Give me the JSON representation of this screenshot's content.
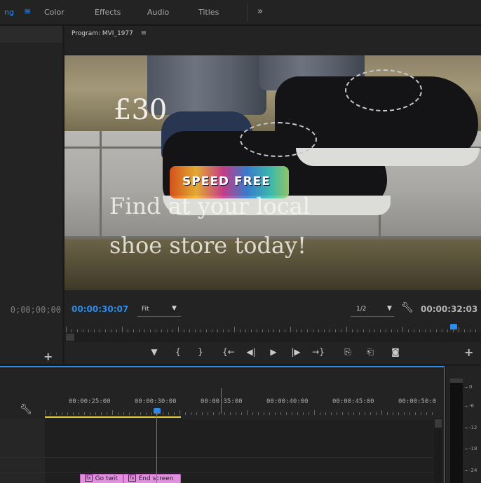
{
  "topbar": {
    "workspaces": [
      "ng",
      "Color",
      "Effects",
      "Audio",
      "Titles"
    ],
    "more": "»"
  },
  "source": {
    "timecode": "0;00;00;00",
    "add_button": "+"
  },
  "program": {
    "title": "Program: MVI_1977",
    "menu_icon": "≡",
    "overlay": {
      "price": "£30",
      "caption_line1": "Find at your local",
      "caption_line2": "shoe store today!",
      "shoe_logo": "SPEED FREE"
    },
    "current_time": "00:00:30:07",
    "zoom": "Fit",
    "resolution": "1/2",
    "duration": "00:00:32:03",
    "add_button": "+",
    "transport_icons": [
      "marker-icon",
      "mark-in-icon",
      "mark-out-icon",
      "go-to-in-icon",
      "step-back-icon",
      "play-icon",
      "step-forward-icon",
      "go-to-out-icon",
      "lift-icon",
      "extract-icon",
      "export-frame-icon"
    ],
    "transport_glyphs": [
      "▼",
      "{",
      "}",
      "{←",
      "◀|",
      "▶",
      "|▶",
      "→}",
      "⎘",
      "⎗",
      "◙"
    ]
  },
  "timeline": {
    "ruler_labels": [
      "00:00:25:00",
      "00:00:30:00",
      "00:00:35:00",
      "00:00:40:00",
      "00:00:45:00",
      "00:00:50:0"
    ],
    "clips": [
      {
        "fx": "fx",
        "label": "Go twit"
      },
      {
        "fx": "fx",
        "label": "End screen"
      }
    ]
  },
  "audio_meter": {
    "labels": [
      "0",
      "-6",
      "-12",
      "-18",
      "-24"
    ]
  },
  "colors": {
    "accent": "#2d8ceb",
    "work_area": "#e5d23a",
    "clip": "#e38ee0"
  }
}
